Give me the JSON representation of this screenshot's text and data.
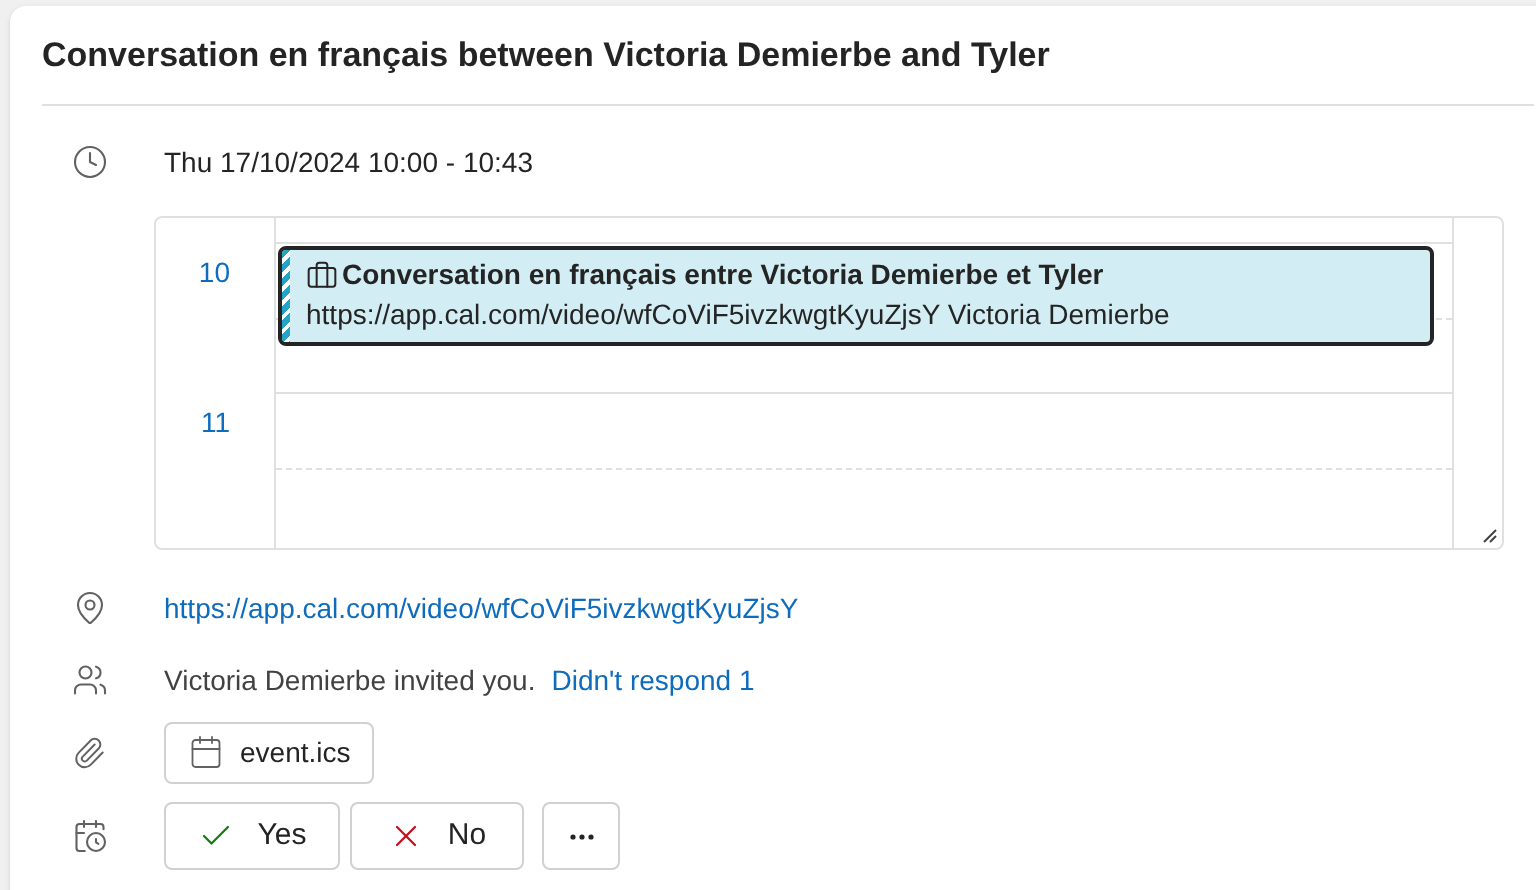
{
  "title": "Conversation en français between Victoria Demierbe and Tyler",
  "time": "Thu 17/10/2024 10:00 - 10:43",
  "calendar": {
    "hours": [
      "10",
      "11"
    ],
    "event": {
      "title": "Conversation en français entre Victoria Demierbe et Tyler",
      "details": "https://app.cal.com/video/wfCoViF5ivzkwgtKyuZjsY Victoria Demierbe"
    }
  },
  "location_link": "https://app.cal.com/video/wfCoViF5ivzkwgtKyuZjsY",
  "invitation": {
    "text": "Victoria Demierbe invited you.",
    "link": "Didn't respond 1"
  },
  "attachment": "event.ics",
  "responses": [
    {
      "kind": "accept",
      "label": "Yes"
    },
    {
      "kind": "decline",
      "label": "No"
    },
    {
      "kind": "more"
    }
  ]
}
